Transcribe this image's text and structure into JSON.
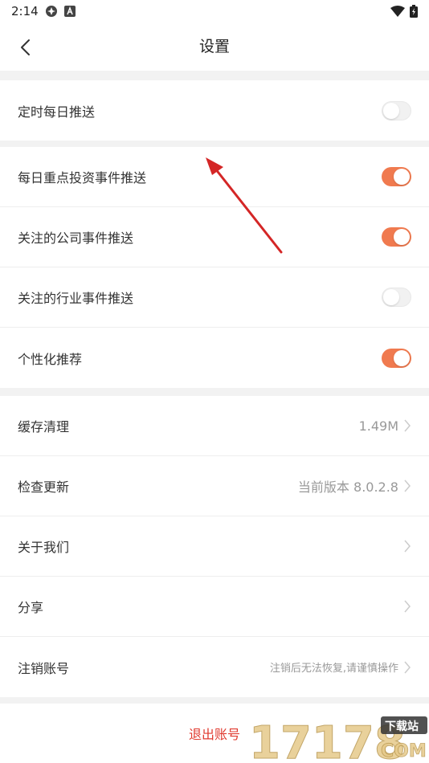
{
  "status_bar": {
    "time": "2:14"
  },
  "header": {
    "title": "设置"
  },
  "groups": {
    "daily": {
      "label": "定时每日推送",
      "enabled": false
    },
    "push": [
      {
        "label": "每日重点投资事件推送",
        "enabled": true
      },
      {
        "label": "关注的公司事件推送",
        "enabled": true
      },
      {
        "label": "关注的行业事件推送",
        "enabled": false
      },
      {
        "label": "个性化推荐",
        "enabled": true
      }
    ],
    "misc": [
      {
        "label": "缓存清理",
        "value": "1.49M"
      },
      {
        "label": "检查更新",
        "value": "当前版本 8.0.2.8"
      },
      {
        "label": "关于我们",
        "value": ""
      },
      {
        "label": "分享",
        "value": ""
      },
      {
        "label": "注销账号",
        "value": "注销后无法恢复,请谨慎操作"
      }
    ]
  },
  "logout": {
    "label": "退出账号"
  },
  "watermark": {
    "number": "17178",
    "site": "下载站",
    "domain": "COM"
  },
  "colors": {
    "accent": "#f07a4f",
    "logout": "#e03a2f",
    "annotation_arrow": "#d42626"
  }
}
